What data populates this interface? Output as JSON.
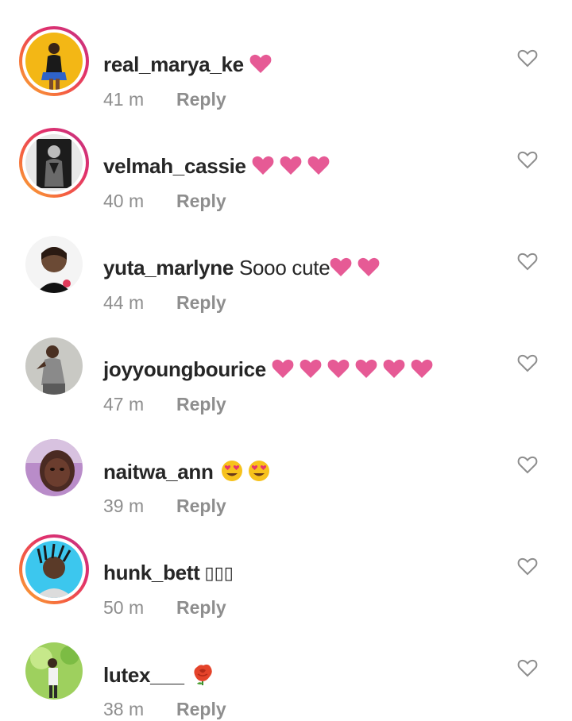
{
  "accent_heart_color": "#e65a95",
  "secondary_text_color": "#8e8e8e",
  "comments": [
    {
      "username": "real_marya_ke",
      "text": "",
      "emoji": [
        "red-heart"
      ],
      "time": "41 m",
      "reply": "Reply",
      "avatar_icon": "avatar-photo",
      "has_story_ring": true
    },
    {
      "username": "velmah_cassie",
      "text": "",
      "emoji": [
        "red-heart",
        "red-heart",
        "red-heart"
      ],
      "time": "40 m",
      "reply": "Reply",
      "avatar_icon": "avatar-photo",
      "has_story_ring": true
    },
    {
      "username": "yuta_marlyne",
      "text": "Sooo cute",
      "emoji": [
        "red-heart",
        "red-heart"
      ],
      "time": "44 m",
      "reply": "Reply",
      "avatar_icon": "avatar-photo",
      "has_story_ring": false
    },
    {
      "username": "joyyoungbourice",
      "text": "",
      "emoji": [
        "red-heart",
        "red-heart",
        "red-heart",
        "red-heart",
        "red-heart",
        "red-heart"
      ],
      "time": "47 m",
      "reply": "Reply",
      "avatar_icon": "avatar-photo",
      "has_story_ring": false
    },
    {
      "username": "naitwa_ann",
      "text": "",
      "emoji": [
        "heart-eyes-face",
        "heart-eyes-face"
      ],
      "time": "39 m",
      "reply": "Reply",
      "avatar_icon": "avatar-photo",
      "has_story_ring": false
    },
    {
      "username": "hunk_bett",
      "text": "▯▯▯",
      "emoji": [],
      "time": "50 m",
      "reply": "Reply",
      "avatar_icon": "avatar-photo",
      "has_story_ring": true
    },
    {
      "username": "lutex___",
      "text": "",
      "emoji": [
        "rose"
      ],
      "time": "38 m",
      "reply": "Reply",
      "avatar_icon": "avatar-photo",
      "has_story_ring": false
    }
  ],
  "like_icon": "heart-outline-icon"
}
